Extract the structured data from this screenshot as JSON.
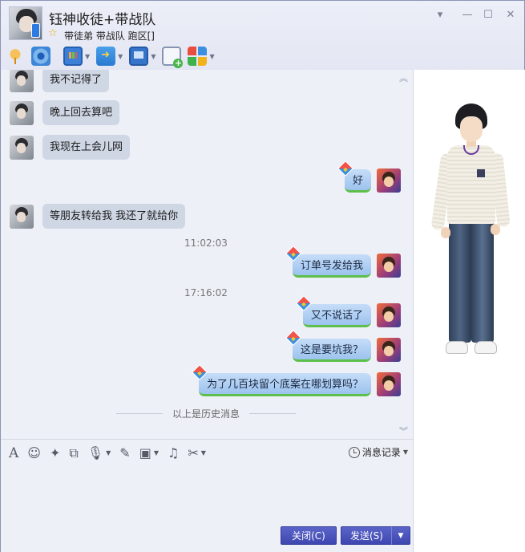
{
  "header": {
    "contact_name": "钰神收徒+带战队",
    "contact_sub": "带徒弟 带战队 跑区[]",
    "minimize_glyph": "▾",
    "min_glyph": "—",
    "max_glyph": "☐",
    "close_glyph": "✕"
  },
  "toolbar": {
    "items": [
      {
        "name": "voice-call",
        "icon": "microphone-icon"
      },
      {
        "name": "video-call",
        "icon": "camera-icon"
      },
      {
        "name": "remote-share",
        "icon": "screen-share-icon"
      },
      {
        "name": "send-file",
        "icon": "folder-icon"
      },
      {
        "name": "remote-desktop",
        "icon": "monitor-icon"
      },
      {
        "name": "create-discussion",
        "icon": "note-add-icon"
      },
      {
        "name": "apps",
        "icon": "apps-grid-icon"
      }
    ]
  },
  "messages": [
    {
      "side": "in",
      "text": "我不记得了"
    },
    {
      "side": "in",
      "text": "晚上回去算吧"
    },
    {
      "side": "in",
      "text": "我现在上会儿网"
    },
    {
      "side": "out",
      "text": "好"
    },
    {
      "side": "in",
      "text": "等朋友转给我 我还了就给你"
    },
    {
      "side": "time",
      "text": "11:02:03"
    },
    {
      "side": "out",
      "text": "订单号发给我"
    },
    {
      "side": "time",
      "text": "17:16:02"
    },
    {
      "side": "out",
      "text": "又不说话了"
    },
    {
      "side": "out",
      "text": "这是要坑我？"
    },
    {
      "side": "out",
      "text": "为了几百块留个底案在哪划算吗？"
    }
  ],
  "history_divider": "以上是历史消息",
  "input": {
    "history_label": "消息记录",
    "compose_value": "",
    "close_label": "关闭(C)",
    "send_label": "发送(S)",
    "send_options_glyph": "▼"
  },
  "colors": {
    "accent": "#4a53bd",
    "bubble_out": "#a9cbf1",
    "bubble_in": "#cfd6e4",
    "bubble_out_underline": "#5cc04a"
  }
}
